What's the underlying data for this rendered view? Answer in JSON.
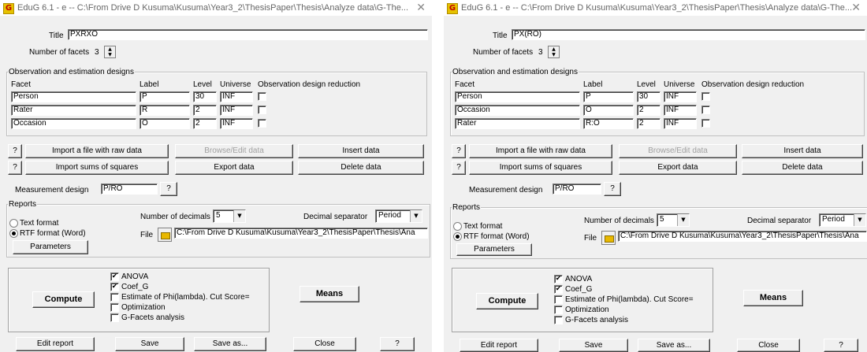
{
  "windows": [
    {
      "title": "EduG 6.1 - e -- C:\\From Drive D Kusuma\\Kusuma\\Year3_2\\ThesisPaper\\Thesis\\Analyze data\\G-The...",
      "title_label": "Title",
      "title_value": "PXRXO",
      "facets_label": "Number of facets",
      "facets_value": "3",
      "design_group": "Observation and estimation designs",
      "headers": [
        "Facet",
        "Label",
        "Level",
        "Universe",
        "Observation design reduction"
      ],
      "rows": [
        {
          "facet": "Person",
          "label": "P",
          "level": "30",
          "universe": "INF"
        },
        {
          "facet": "Rater",
          "label": "R",
          "level": "2",
          "universe": "INF"
        },
        {
          "facet": "Occasion",
          "label": "O",
          "level": "2",
          "universe": "INF"
        }
      ],
      "buttons": {
        "help": "?",
        "import_raw": "Import a file with raw data",
        "browse": "Browse/Edit data",
        "insert": "Insert data",
        "import_sums": "Import sums of squares",
        "export": "Export data",
        "delete": "Delete data"
      },
      "measurement_label": "Measurement design",
      "measurement_value": "P/RO",
      "reports": {
        "label": "Reports",
        "text_format": "Text format",
        "rtf_format": "RTF format (Word)",
        "parameters": "Parameters",
        "decimals_label": "Number of decimals",
        "decimals_value": "5",
        "separator_label": "Decimal separator",
        "separator_value": "Period",
        "file_label": "File",
        "file_value": "C:\\From Drive D Kusuma\\Kusuma\\Year3_2\\ThesisPaper\\Thesis\\Ana"
      },
      "compute": {
        "compute_label": "Compute",
        "means_label": "Means",
        "options": [
          {
            "label": "ANOVA",
            "checked": true
          },
          {
            "label": "Coef_G",
            "checked": true
          },
          {
            "label": "Estimate of Phi(lambda). Cut Score=",
            "checked": false
          },
          {
            "label": "Optimization",
            "checked": false
          },
          {
            "label": "G-Facets analysis",
            "checked": false
          }
        ]
      },
      "bottom": {
        "edit": "Edit report",
        "save": "Save",
        "saveas": "Save as...",
        "close": "Close",
        "help": "?"
      }
    },
    {
      "title": "EduG 6.1 - e -- C:\\From Drive D Kusuma\\Kusuma\\Year3_2\\ThesisPaper\\Thesis\\Analyze data\\G-The...",
      "title_label": "Title",
      "title_value": "PX(RO)",
      "facets_label": "Number of facets",
      "facets_value": "3",
      "design_group": "Observation and estimation designs",
      "headers": [
        "Facet",
        "Label",
        "Level",
        "Universe",
        "Observation design reduction"
      ],
      "rows": [
        {
          "facet": "Person",
          "label": "P",
          "level": "30",
          "universe": "INF"
        },
        {
          "facet": "Occasion",
          "label": "O",
          "level": "2",
          "universe": "INF"
        },
        {
          "facet": "Rater",
          "label": "R:O",
          "level": "2",
          "universe": "INF"
        }
      ],
      "buttons": {
        "help": "?",
        "import_raw": "Import a file with raw data",
        "browse": "Browse/Edit data",
        "insert": "Insert data",
        "import_sums": "Import sums of squares",
        "export": "Export data",
        "delete": "Delete data"
      },
      "measurement_label": "Measurement design",
      "measurement_value": "P/RO",
      "reports": {
        "label": "Reports",
        "text_format": "Text format",
        "rtf_format": "RTF format (Word)",
        "parameters": "Parameters",
        "decimals_label": "Number of decimals",
        "decimals_value": "5",
        "separator_label": "Decimal separator",
        "separator_value": "Period",
        "file_label": "File",
        "file_value": "C:\\From Drive D Kusuma\\Kusuma\\Year3_2\\ThesisPaper\\Thesis\\Ana"
      },
      "compute": {
        "compute_label": "Compute",
        "means_label": "Means",
        "options": [
          {
            "label": "ANOVA",
            "checked": true
          },
          {
            "label": "Coef_G",
            "checked": true
          },
          {
            "label": "Estimate of Phi(lambda). Cut Score=",
            "checked": false
          },
          {
            "label": "Optimization",
            "checked": false
          },
          {
            "label": "G-Facets analysis",
            "checked": false
          }
        ]
      },
      "bottom": {
        "edit": "Edit report",
        "save": "Save",
        "saveas": "Save as...",
        "close": "Close",
        "help": "?"
      }
    }
  ],
  "icons": {
    "logo": "edug-logo-icon",
    "close": "close-icon",
    "folder": "folder-open-icon",
    "check": "✔"
  }
}
